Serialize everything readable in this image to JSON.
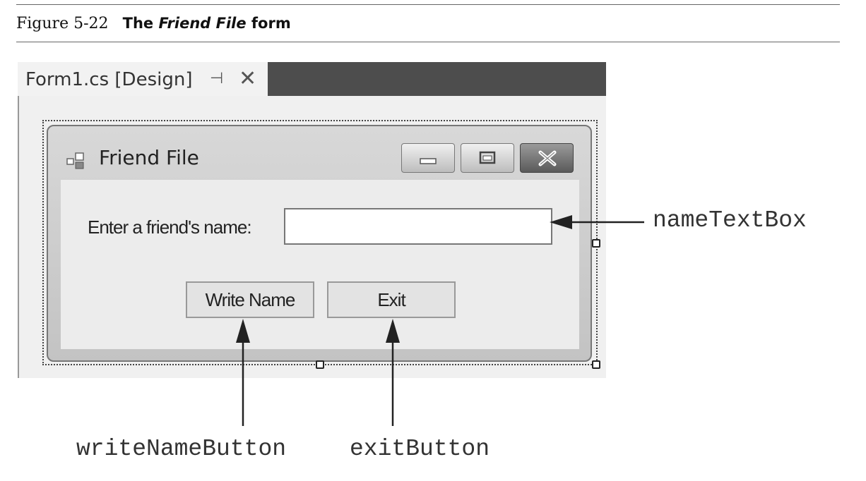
{
  "caption": {
    "figure_number": "Figure 5-22",
    "title_prefix": "The ",
    "title_italic": "Friend File",
    "title_suffix": " form"
  },
  "designer": {
    "tab_label": "Form1.cs [Design]",
    "pin_glyph": "⊣",
    "close_glyph": "✕"
  },
  "form": {
    "title": "Friend File",
    "name_label": "Enter a friend's name:",
    "name_value": "",
    "write_button_label": "Write Name",
    "exit_button_label": "Exit"
  },
  "callouts": {
    "text_box": "nameTextBox",
    "write_button": "writeNameButton",
    "exit_button": "exitButton"
  }
}
